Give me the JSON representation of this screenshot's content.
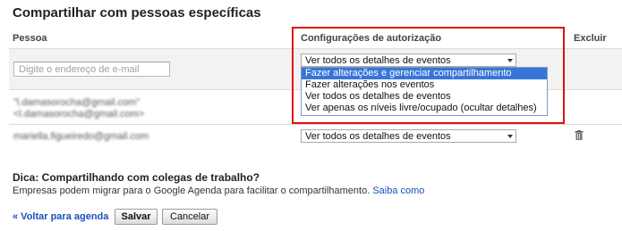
{
  "dialog": {
    "title": "Compartilhar com pessoas específicas"
  },
  "columns": {
    "person": "Pessoa",
    "permissions": "Configurações de autorização",
    "delete": "Excluir"
  },
  "new_row": {
    "email_placeholder": "Digite o endereço de e-mail",
    "permission_selected": "Ver todos os detalhes de eventos",
    "dropdown_options": [
      "Fazer alterações e gerenciar compartilhamento",
      "Fazer alterações nos eventos",
      "Ver todos os detalhes de eventos",
      "Ver apenas os níveis livre/ocupado (ocultar detalhes)"
    ],
    "highlighted_option_index": 0
  },
  "owner_row": {
    "email_line1": "\"l.damasorocha@gmail.com\"",
    "email_line2": "<l.damasorocha@gmail.com>"
  },
  "shared_rows": [
    {
      "email": "mariella.figueiredo@gmail.com",
      "permission": "Ver todos os detalhes de eventos"
    }
  ],
  "tip": {
    "title": "Dica: Compartilhando com colegas de trabalho?",
    "text": "Empresas podem migrar para o Google Agenda para facilitar o compartilhamento.",
    "link": "Saiba como"
  },
  "footer": {
    "back_link": "« Voltar para agenda",
    "save": "Salvar",
    "cancel": "Cancelar"
  },
  "colors": {
    "highlight": "#3875d7",
    "annotation_border": "#dd1111",
    "link": "#1a4fbf"
  }
}
